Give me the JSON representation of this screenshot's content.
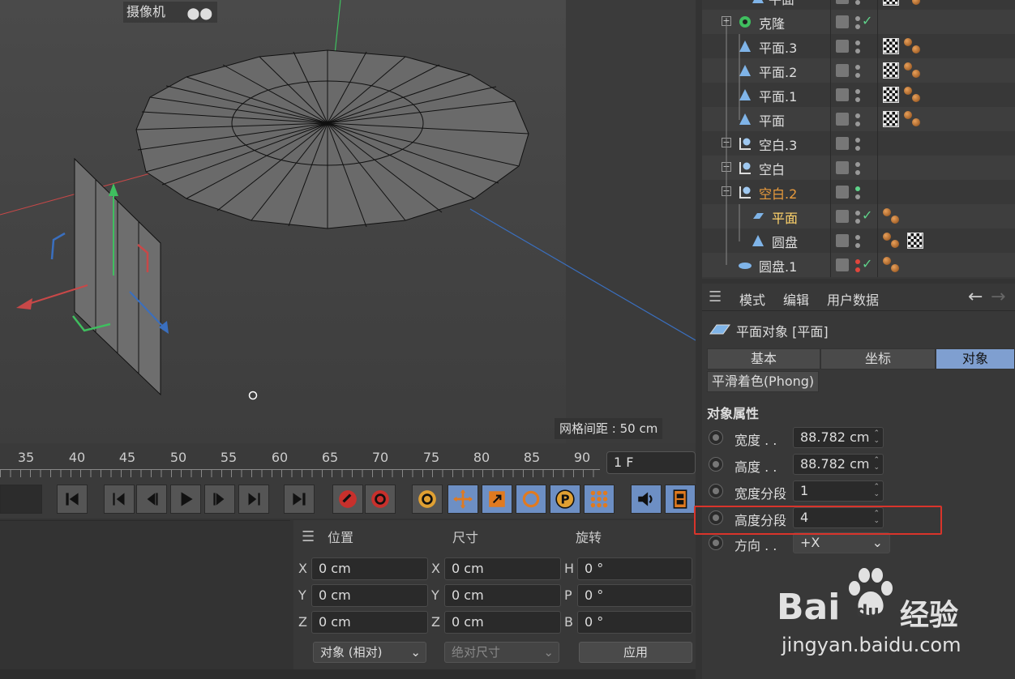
{
  "viewport": {
    "camera_label": "摄像机",
    "grid_spacing": "网格间距 : 50 cm"
  },
  "timeline": {
    "ticks": [
      "35",
      "40",
      "45",
      "50",
      "55",
      "60",
      "65",
      "70",
      "75",
      "80",
      "85",
      "90"
    ],
    "frame": "1 F"
  },
  "coords": {
    "headers": {
      "position": "位置",
      "size": "尺寸",
      "rotation": "旋转"
    },
    "rows": [
      {
        "axis": "X",
        "pos": "0 cm",
        "saxis": "X",
        "size": "0 cm",
        "raxis": "H",
        "rot": "0 °"
      },
      {
        "axis": "Y",
        "pos": "0 cm",
        "saxis": "Y",
        "size": "0 cm",
        "raxis": "P",
        "rot": "0 °"
      },
      {
        "axis": "Z",
        "pos": "0 cm",
        "saxis": "Z",
        "size": "0 cm",
        "raxis": "B",
        "rot": "0 °"
      }
    ],
    "mode": "对象 (相对)",
    "size_mode": "绝对尺寸",
    "apply": "应用"
  },
  "objects": [
    {
      "name": "平面",
      "indent": 2
    },
    {
      "name": "克隆",
      "indent": 0
    },
    {
      "name": "平面.3",
      "indent": 1
    },
    {
      "name": "平面.2",
      "indent": 1
    },
    {
      "name": "平面.1",
      "indent": 1
    },
    {
      "name": "平面",
      "indent": 1
    },
    {
      "name": "空白.3",
      "indent": 0
    },
    {
      "name": "空白",
      "indent": 0
    },
    {
      "name": "空白.2",
      "indent": 0
    },
    {
      "name": "平面",
      "indent": 1
    },
    {
      "name": "圆盘",
      "indent": 1
    },
    {
      "name": "圆盘.1",
      "indent": 0
    }
  ],
  "attributes": {
    "menu": [
      "模式",
      "编辑",
      "用户数据"
    ],
    "title": "平面对象 [平面]",
    "tabs": [
      "基本",
      "坐标",
      "对象"
    ],
    "phong_tab": "平滑着色(Phong)",
    "section": "对象属性",
    "props": [
      {
        "label": "宽度 . .",
        "value": "88.782 cm"
      },
      {
        "label": "高度 . .",
        "value": "88.782 cm"
      },
      {
        "label": "宽度分段",
        "value": "1"
      },
      {
        "label": "高度分段",
        "value": "4"
      },
      {
        "label": "方向 . .",
        "value": "+X"
      }
    ]
  },
  "watermark": {
    "brand": "Bai",
    "brand_du": "du",
    "cn": "经验",
    "url": "jingyan.baidu.com"
  }
}
